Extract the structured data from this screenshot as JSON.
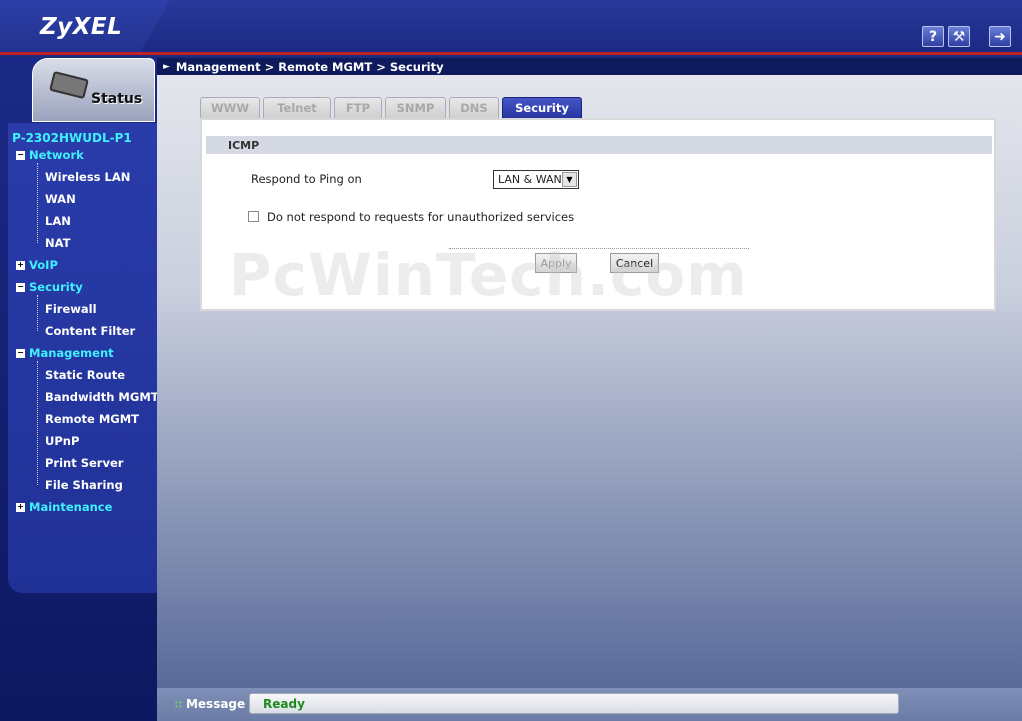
{
  "header": {
    "logo": "ZyXEL",
    "help_label": "?",
    "wizard_label": "⚒",
    "logout_label": "➜"
  },
  "breadcrumb": "Management > Remote MGMT > Security",
  "sidebar": {
    "status_label": "Status",
    "device_name": "P-2302HWUDL-P1",
    "network": {
      "label": "Network",
      "items": [
        "Wireless LAN",
        "WAN",
        "LAN",
        "NAT"
      ]
    },
    "voip": {
      "label": "VoIP"
    },
    "security": {
      "label": "Security",
      "items": [
        "Firewall",
        "Content Filter"
      ]
    },
    "management": {
      "label": "Management",
      "items": [
        "Static Route",
        "Bandwidth MGMT",
        "Remote MGMT",
        "UPnP",
        "Print Server",
        "File Sharing"
      ]
    },
    "maintenance": {
      "label": "Maintenance"
    }
  },
  "tabs": [
    "WWW",
    "Telnet",
    "FTP",
    "SNMP",
    "DNS",
    "Security"
  ],
  "active_tab": "Security",
  "icmp": {
    "section_title": "ICMP",
    "respond_ping_label": "Respond to Ping on",
    "respond_ping_value": "LAN & WAN",
    "no_respond_label": "Do not respond to requests for unauthorized services",
    "no_respond_checked": false
  },
  "buttons": {
    "apply": "Apply",
    "cancel": "Cancel"
  },
  "watermark": "PcWinTech.com",
  "status_bar": {
    "label": "Message",
    "value": "Ready"
  },
  "colors": {
    "accent_cyan": "#3ff0ff",
    "header_red": "#c0202a",
    "ready_green": "#1e8a1e"
  }
}
